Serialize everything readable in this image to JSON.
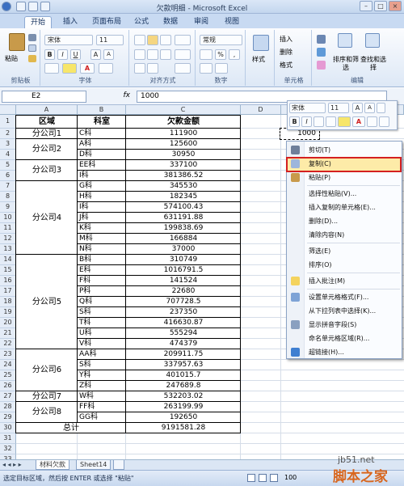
{
  "window": {
    "title": "欠款明细 - Microsoft Excel",
    "minimize": "–",
    "maximize": "□",
    "close": "×"
  },
  "ribbon_tabs": [
    "开始",
    "插入",
    "页面布局",
    "公式",
    "数据",
    "审阅",
    "视图"
  ],
  "ribbon": {
    "paste_label": "粘贴",
    "font_name": "宋体",
    "font_size": "11",
    "number_format": "常规",
    "style_label": "样式",
    "cell_buttons": [
      "插入",
      "删除",
      "格式"
    ],
    "sort_label": "排序和筛选",
    "find_label": "查找和选择",
    "group_labels": [
      "剪贴板",
      "字体",
      "对齐方式",
      "数字",
      "单元格",
      "编辑"
    ],
    "bold": "B",
    "italic": "I",
    "underline": "U",
    "grow_font": "A",
    "shrink_font": "A",
    "number_symbols": [
      "%",
      ","
    ]
  },
  "formula_bar": {
    "name_box": "E2",
    "fx": "fx",
    "value": "1000"
  },
  "columns": [
    "A",
    "B",
    "C",
    "D"
  ],
  "table": {
    "header": {
      "a": "区域",
      "b": "科室",
      "c": "欠款金额"
    },
    "regions": [
      {
        "name": "分公司1",
        "start": 2,
        "end": 2
      },
      {
        "name": "分公司2",
        "start": 3,
        "end": 4
      },
      {
        "name": "分公司3",
        "start": 5,
        "end": 6
      },
      {
        "name": "分公司4",
        "start": 7,
        "end": 13
      },
      {
        "name": "分公司5",
        "start": 14,
        "end": 22
      },
      {
        "name": "分公司6",
        "start": 23,
        "end": 26
      },
      {
        "name": "分公司7",
        "start": 27,
        "end": 27
      },
      {
        "name": "分公司8",
        "start": 28,
        "end": 29
      }
    ],
    "rows": [
      {
        "dept": "C科",
        "amount": "111900"
      },
      {
        "dept": "A科",
        "amount": "125600"
      },
      {
        "dept": "D科",
        "amount": "30950"
      },
      {
        "dept": "EE科",
        "amount": "337100"
      },
      {
        "dept": "I科",
        "amount": "381386.52"
      },
      {
        "dept": "G科",
        "amount": "345530"
      },
      {
        "dept": "H科",
        "amount": "182345"
      },
      {
        "dept": "I科",
        "amount": "574100.43"
      },
      {
        "dept": "J科",
        "amount": "631191.88"
      },
      {
        "dept": "K科",
        "amount": "199838.69"
      },
      {
        "dept": "M科",
        "amount": "166884"
      },
      {
        "dept": "N科",
        "amount": "37000"
      },
      {
        "dept": "B科",
        "amount": "310749"
      },
      {
        "dept": "E科",
        "amount": "1016791.5"
      },
      {
        "dept": "F科",
        "amount": "141524"
      },
      {
        "dept": "P科",
        "amount": "22680"
      },
      {
        "dept": "Q科",
        "amount": "707728.5"
      },
      {
        "dept": "S科",
        "amount": "237350"
      },
      {
        "dept": "T科",
        "amount": "416630.87"
      },
      {
        "dept": "U科",
        "amount": "555294"
      },
      {
        "dept": "V科",
        "amount": "474379"
      },
      {
        "dept": "AA科",
        "amount": "209911.75"
      },
      {
        "dept": "S科",
        "amount": "337957.63"
      },
      {
        "dept": "Y科",
        "amount": "401015.7"
      },
      {
        "dept": "Z科",
        "amount": "247689.8"
      },
      {
        "dept": "W科",
        "amount": "532203.02"
      },
      {
        "dept": "FF科",
        "amount": "263199.99"
      },
      {
        "dept": "GG科",
        "amount": "192650"
      }
    ],
    "total_label": "总计",
    "total_amount": "9191581.28"
  },
  "row_numbers": [
    "1",
    "2",
    "3",
    "4",
    "5",
    "6",
    "7",
    "8",
    "9",
    "10",
    "11",
    "12",
    "13",
    "14",
    "15",
    "16",
    "17",
    "18",
    "19",
    "20",
    "21",
    "22",
    "23",
    "24",
    "25",
    "26",
    "27",
    "28",
    "29",
    "30",
    "31",
    "32",
    "33"
  ],
  "selected_cell_value": "1000",
  "sheet_tabs": [
    "材料欠款",
    "Sheet14"
  ],
  "status": {
    "text": "选定目标区域，然后按 ENTER 或选择 \"粘贴\"",
    "zoom": "100"
  },
  "mini_toolbar": {
    "font": "宋体",
    "size": "11"
  },
  "context_menu": [
    {
      "label": "剪切(T)",
      "icon": "scissors-icon"
    },
    {
      "label": "复制(C)",
      "icon": "copy-icon",
      "highlighted": true
    },
    {
      "label": "粘贴(P)",
      "icon": "paste-icon"
    },
    {
      "label": "选择性粘贴(V)...",
      "icon": ""
    },
    {
      "label": "插入复制的单元格(E)...",
      "icon": ""
    },
    {
      "label": "删除(D)...",
      "icon": ""
    },
    {
      "label": "清除内容(N)",
      "icon": ""
    },
    {
      "label": "筛选(E)",
      "icon": ""
    },
    {
      "label": "排序(O)",
      "icon": ""
    },
    {
      "label": "插入批注(M)",
      "icon": "comment-icon"
    },
    {
      "label": "设置单元格格式(F)...",
      "icon": "format-cells-icon"
    },
    {
      "label": "从下拉列表中选择(K)...",
      "icon": ""
    },
    {
      "label": "显示拼音字段(S)",
      "icon": "phonetic-icon"
    },
    {
      "label": "命名单元格区域(R)...",
      "icon": ""
    },
    {
      "label": "超链接(H)...",
      "icon": "hyperlink-icon"
    }
  ],
  "watermark": {
    "top": "jb51.net",
    "bottom": "脚本之家"
  },
  "colors": {
    "accent": "#1e5fa6",
    "highlight_border": "#d42020"
  }
}
